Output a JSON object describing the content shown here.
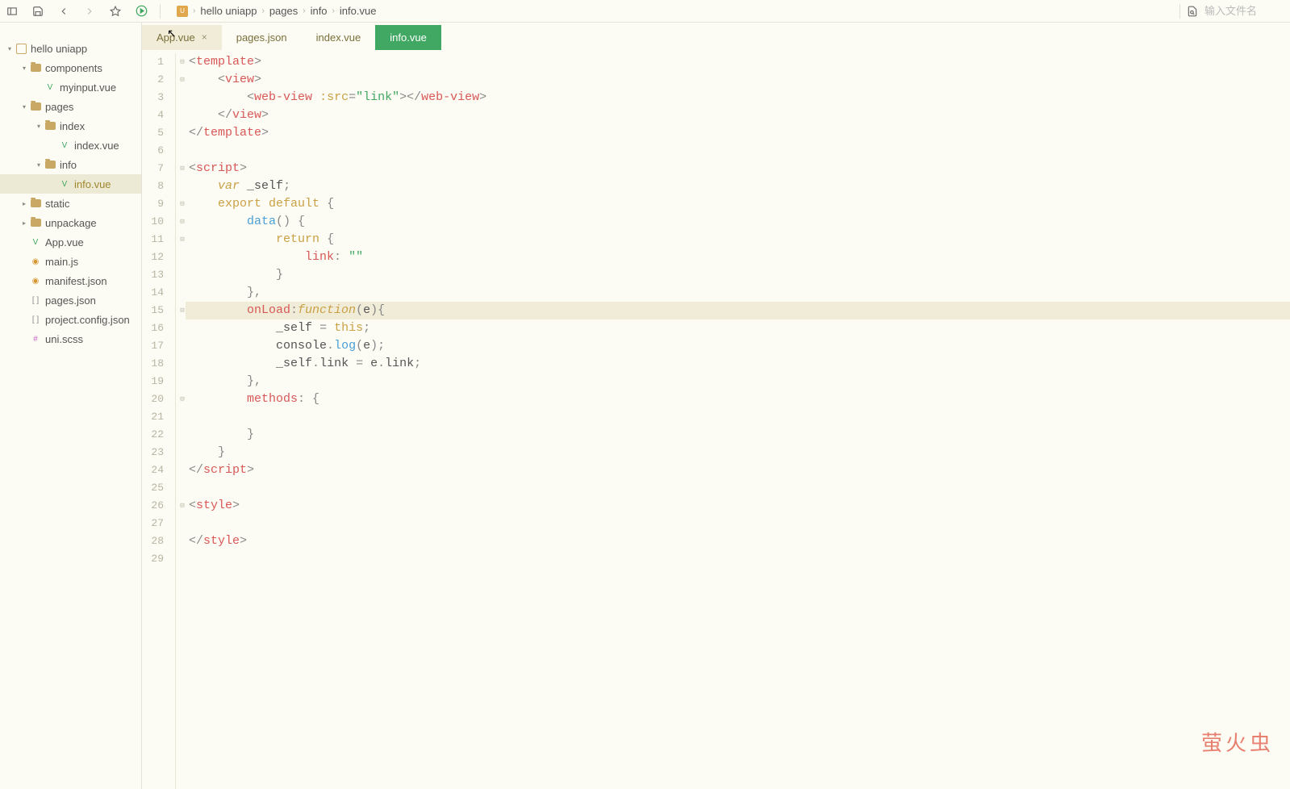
{
  "breadcrumb": [
    "hello uniapp",
    "pages",
    "info",
    "info.vue"
  ],
  "search_placeholder": "输入文件名",
  "tabs": [
    {
      "label": "App.vue",
      "dirty": true,
      "active": false
    },
    {
      "label": "pages.json",
      "dirty": false,
      "active": false
    },
    {
      "label": "index.vue",
      "dirty": false,
      "active": false
    },
    {
      "label": "info.vue",
      "dirty": false,
      "active": true
    }
  ],
  "tree": {
    "project": "hello uniapp",
    "items": [
      {
        "name": "components",
        "type": "folder",
        "level": 1,
        "expanded": true
      },
      {
        "name": "myinput.vue",
        "type": "file-v",
        "level": 2
      },
      {
        "name": "pages",
        "type": "folder",
        "level": 1,
        "expanded": true
      },
      {
        "name": "index",
        "type": "folder",
        "level": 2,
        "expanded": true
      },
      {
        "name": "index.vue",
        "type": "file-v",
        "level": 3
      },
      {
        "name": "info",
        "type": "folder",
        "level": 2,
        "expanded": true
      },
      {
        "name": "info.vue",
        "type": "file-v",
        "level": 3,
        "selected": true
      },
      {
        "name": "static",
        "type": "folder",
        "level": 1,
        "expanded": false
      },
      {
        "name": "unpackage",
        "type": "folder",
        "level": 1,
        "expanded": false
      },
      {
        "name": "App.vue",
        "type": "file-v",
        "level": 1
      },
      {
        "name": "main.js",
        "type": "file-o",
        "level": 1
      },
      {
        "name": "manifest.json",
        "type": "file-o",
        "level": 1
      },
      {
        "name": "pages.json",
        "type": "file-j",
        "level": 1
      },
      {
        "name": "project.config.json",
        "type": "file-j",
        "level": 1
      },
      {
        "name": "uni.scss",
        "type": "file-s",
        "level": 1
      }
    ]
  },
  "code": {
    "highlighted_line": 15,
    "lines": [
      {
        "n": 1,
        "fold": "⊟",
        "html": "<span class='pun'>&lt;</span><span class='tag'>template</span><span class='pun'>&gt;</span>"
      },
      {
        "n": 2,
        "fold": "⊟",
        "indent": 4,
        "html": "<span class='pun'>&lt;</span><span class='tag'>view</span><span class='pun'>&gt;</span>"
      },
      {
        "n": 3,
        "fold": "",
        "indent": 8,
        "html": "<span class='pun'>&lt;</span><span class='tag'>web-view</span> <span class='attr'>:src</span><span class='pun'>=</span><span class='str'>\"link\"</span><span class='pun'>&gt;&lt;/</span><span class='tag'>web-view</span><span class='pun'>&gt;</span>"
      },
      {
        "n": 4,
        "fold": "",
        "indent": 4,
        "html": "<span class='pun'>&lt;/</span><span class='tag'>view</span><span class='pun'>&gt;</span>"
      },
      {
        "n": 5,
        "fold": "",
        "html": "<span class='pun'>&lt;/</span><span class='tag'>template</span><span class='pun'>&gt;</span>"
      },
      {
        "n": 6,
        "fold": "",
        "html": ""
      },
      {
        "n": 7,
        "fold": "⊟",
        "html": "<span class='pun'>&lt;</span><span class='tag'>script</span><span class='pun'>&gt;</span>"
      },
      {
        "n": 8,
        "fold": "",
        "indent": 4,
        "html": "<span class='kw'>var</span> <span class='ident'>_self</span><span class='pun'>;</span>"
      },
      {
        "n": 9,
        "fold": "⊟",
        "indent": 4,
        "html": "<span class='kw2'>export</span> <span class='kw2'>default</span> <span class='pun'>{</span>"
      },
      {
        "n": 10,
        "fold": "⊟",
        "indent": 8,
        "html": "<span class='fn'>data</span><span class='pun'>() {</span>"
      },
      {
        "n": 11,
        "fold": "⊟",
        "indent": 12,
        "html": "<span class='kw2'>return</span> <span class='pun'>{</span>"
      },
      {
        "n": 12,
        "fold": "",
        "indent": 16,
        "html": "<span class='prop'>link</span><span class='pun'>:</span> <span class='str'>\"\"</span>"
      },
      {
        "n": 13,
        "fold": "",
        "indent": 12,
        "html": "<span class='pun'>}</span>"
      },
      {
        "n": 14,
        "fold": "",
        "indent": 8,
        "html": "<span class='pun'>},</span>"
      },
      {
        "n": 15,
        "fold": "⊟",
        "indent": 8,
        "html": "<span class='prop'>onLoad</span><span class='pun'>:</span><span class='kw italic'>function</span><span class='pun'>(</span><span class='ident'>e</span><span class='pun'>){</span>"
      },
      {
        "n": 16,
        "fold": "",
        "indent": 12,
        "html": "<span class='ident'>_self</span> <span class='pun'>=</span> <span class='kw2'>this</span><span class='pun'>;</span>"
      },
      {
        "n": 17,
        "fold": "",
        "indent": 12,
        "html": "<span class='ident'>console</span><span class='pun'>.</span><span class='fn'>log</span><span class='pun'>(</span><span class='ident'>e</span><span class='pun'>);</span>"
      },
      {
        "n": 18,
        "fold": "",
        "indent": 12,
        "html": "<span class='ident'>_self</span><span class='pun'>.</span><span class='ident'>link</span> <span class='pun'>=</span> <span class='ident'>e</span><span class='pun'>.</span><span class='ident'>link</span><span class='pun'>;</span>"
      },
      {
        "n": 19,
        "fold": "",
        "indent": 8,
        "html": "<span class='pun'>},</span>"
      },
      {
        "n": 20,
        "fold": "⊟",
        "indent": 8,
        "html": "<span class='prop'>methods</span><span class='pun'>: {</span>"
      },
      {
        "n": 21,
        "fold": "",
        "indent": 8,
        "html": ""
      },
      {
        "n": 22,
        "fold": "",
        "indent": 8,
        "html": "<span class='pun'>}</span>"
      },
      {
        "n": 23,
        "fold": "",
        "indent": 4,
        "html": "<span class='pun'>}</span>"
      },
      {
        "n": 24,
        "fold": "",
        "html": "<span class='pun'>&lt;/</span><span class='tag'>script</span><span class='pun'>&gt;</span>"
      },
      {
        "n": 25,
        "fold": "",
        "html": ""
      },
      {
        "n": 26,
        "fold": "⊟",
        "html": "<span class='pun'>&lt;</span><span class='tag'>style</span><span class='pun'>&gt;</span>"
      },
      {
        "n": 27,
        "fold": "",
        "html": ""
      },
      {
        "n": 28,
        "fold": "",
        "html": "<span class='pun'>&lt;/</span><span class='tag'>style</span><span class='pun'>&gt;</span>"
      },
      {
        "n": 29,
        "fold": "",
        "html": ""
      }
    ]
  },
  "watermark": "萤火虫"
}
